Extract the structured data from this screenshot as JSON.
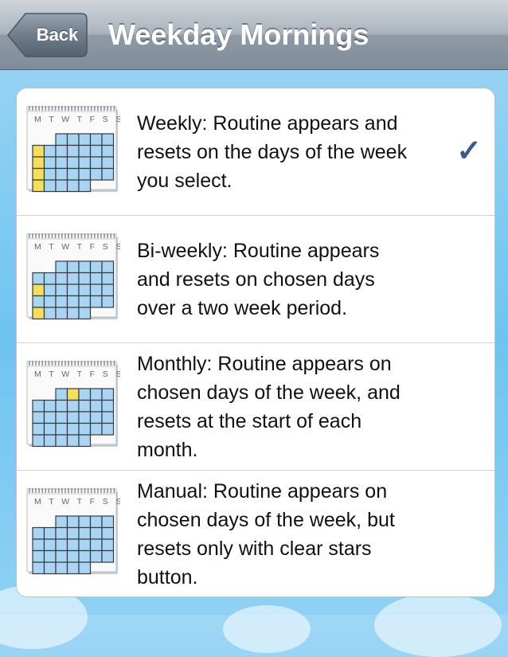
{
  "header": {
    "title": "Weekday Mornings",
    "back_label": "Back"
  },
  "calendar_icon": {
    "day_letters": "M T W T F S S"
  },
  "options": [
    {
      "lines": [
        "Weekly: Routine appears and",
        "resets on the days of the week",
        "you select."
      ],
      "selected": true,
      "highlight": "weekly"
    },
    {
      "lines": [
        "Bi-weekly: Routine appears",
        "and resets on chosen days",
        "over a two week period."
      ],
      "selected": false,
      "highlight": "biweekly"
    },
    {
      "lines": [
        "Monthly: Routine appears on",
        "chosen days of the week, and",
        "resets at the start of each",
        "month."
      ],
      "selected": false,
      "highlight": "monthly"
    },
    {
      "lines": [
        "Manual: Routine appears on",
        "chosen days of the week, but",
        "resets only with clear stars",
        "button."
      ],
      "selected": false,
      "highlight": "none"
    }
  ],
  "icons": {
    "back": "back-arrow-icon",
    "check": "checkmark-icon",
    "calendar": "calendar-icon"
  },
  "colors": {
    "check": "#3b5a8c",
    "cell_blue": "#a9d5f2",
    "cell_yellow": "#f6de57",
    "nav_top": "#cfd5db",
    "nav_bottom": "#7f8b98"
  }
}
